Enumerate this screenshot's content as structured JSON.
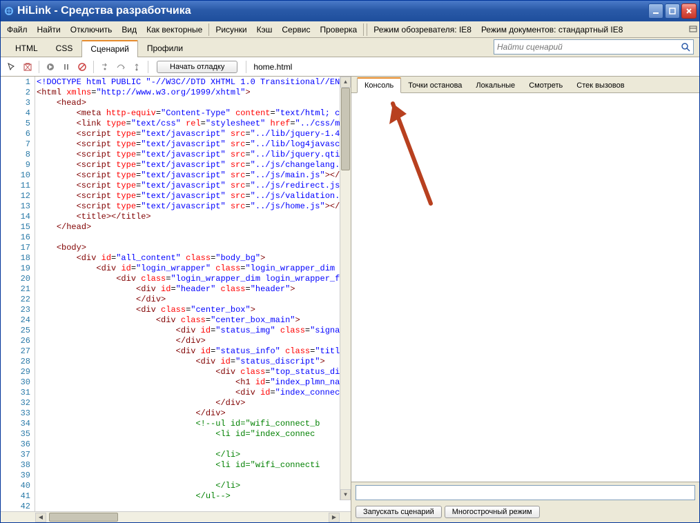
{
  "window": {
    "title": "HiLink - Средства разработчика"
  },
  "menu": {
    "items": [
      "Файл",
      "Найти",
      "Отключить",
      "Вид",
      "Как векторные",
      "Рисунки",
      "Кэш",
      "Сервис",
      "Проверка"
    ],
    "browser_mode_label": "Режим обозревателя: IE8",
    "doc_mode_label": "Режим документов: стандартный IE8"
  },
  "tabs": {
    "items": [
      "HTML",
      "CSS",
      "Сценарий",
      "Профили"
    ],
    "active": "Сценарий"
  },
  "search": {
    "placeholder": "Найти сценарий"
  },
  "toolbar": {
    "debug_label": "Начать отладку",
    "filename": "home.html"
  },
  "right_tabs": {
    "items": [
      "Консоль",
      "Точки останова",
      "Локальные",
      "Смотреть",
      "Стек вызовов"
    ],
    "active": "Консоль"
  },
  "console_buttons": {
    "run": "Запускать сценарий",
    "multiline": "Многострочный режим"
  },
  "code": {
    "start_line": 1,
    "lines": [
      [
        [
          "decl",
          "<!DOCTYPE html PUBLIC \"-//W3C//DTD XHTML 1.0 Transitional//EN"
        ]
      ],
      [
        [
          "tag",
          "<html "
        ],
        [
          "attr",
          "xmlns"
        ],
        [
          "txt",
          "="
        ],
        [
          "val",
          "\"http://www.w3.org/1999/xhtml\""
        ],
        [
          "tag",
          ">"
        ]
      ],
      [
        [
          "txt",
          "    "
        ],
        [
          "tag",
          "<head>"
        ]
      ],
      [
        [
          "txt",
          "        "
        ],
        [
          "tag",
          "<meta "
        ],
        [
          "attr",
          "http-equiv"
        ],
        [
          "txt",
          "="
        ],
        [
          "val",
          "\"Content-Type\""
        ],
        [
          "txt",
          " "
        ],
        [
          "attr",
          "content"
        ],
        [
          "txt",
          "="
        ],
        [
          "val",
          "\"text/html; c"
        ]
      ],
      [
        [
          "txt",
          "        "
        ],
        [
          "tag",
          "<link "
        ],
        [
          "attr",
          "type"
        ],
        [
          "txt",
          "="
        ],
        [
          "val",
          "\"text/css\""
        ],
        [
          "txt",
          " "
        ],
        [
          "attr",
          "rel"
        ],
        [
          "txt",
          "="
        ],
        [
          "val",
          "\"stylesheet\""
        ],
        [
          "txt",
          " "
        ],
        [
          "attr",
          "href"
        ],
        [
          "txt",
          "="
        ],
        [
          "val",
          "\"../css/m"
        ]
      ],
      [
        [
          "txt",
          "        "
        ],
        [
          "tag",
          "<script "
        ],
        [
          "attr",
          "type"
        ],
        [
          "txt",
          "="
        ],
        [
          "val",
          "\"text/javascript\""
        ],
        [
          "txt",
          " "
        ],
        [
          "attr",
          "src"
        ],
        [
          "txt",
          "="
        ],
        [
          "val",
          "\"../lib/jquery-1.4"
        ]
      ],
      [
        [
          "txt",
          "        "
        ],
        [
          "tag",
          "<script "
        ],
        [
          "attr",
          "type"
        ],
        [
          "txt",
          "="
        ],
        [
          "val",
          "\"text/javascript\""
        ],
        [
          "txt",
          " "
        ],
        [
          "attr",
          "src"
        ],
        [
          "txt",
          "="
        ],
        [
          "val",
          "\"../lib/log4javasc"
        ]
      ],
      [
        [
          "txt",
          "        "
        ],
        [
          "tag",
          "<script "
        ],
        [
          "attr",
          "type"
        ],
        [
          "txt",
          "="
        ],
        [
          "val",
          "\"text/javascript\""
        ],
        [
          "txt",
          " "
        ],
        [
          "attr",
          "src"
        ],
        [
          "txt",
          "="
        ],
        [
          "val",
          "\"../lib/jquery.qti"
        ]
      ],
      [
        [
          "txt",
          "        "
        ],
        [
          "tag",
          "<script "
        ],
        [
          "attr",
          "type"
        ],
        [
          "txt",
          "="
        ],
        [
          "val",
          "\"text/javascript\""
        ],
        [
          "txt",
          " "
        ],
        [
          "attr",
          "src"
        ],
        [
          "txt",
          "="
        ],
        [
          "val",
          "\"../js/changelang."
        ]
      ],
      [
        [
          "txt",
          "        "
        ],
        [
          "tag",
          "<script "
        ],
        [
          "attr",
          "type"
        ],
        [
          "txt",
          "="
        ],
        [
          "val",
          "\"text/javascript\""
        ],
        [
          "txt",
          " "
        ],
        [
          "attr",
          "src"
        ],
        [
          "txt",
          "="
        ],
        [
          "val",
          "\"../js/main.js\""
        ],
        [
          "tag",
          ">"
        ],
        [
          "tag",
          "</"
        ]
      ],
      [
        [
          "txt",
          "        "
        ],
        [
          "tag",
          "<script "
        ],
        [
          "attr",
          "type"
        ],
        [
          "txt",
          "="
        ],
        [
          "val",
          "\"text/javascript\""
        ],
        [
          "txt",
          " "
        ],
        [
          "attr",
          "src"
        ],
        [
          "txt",
          "="
        ],
        [
          "val",
          "\"../js/redirect.js"
        ]
      ],
      [
        [
          "txt",
          "        "
        ],
        [
          "tag",
          "<script "
        ],
        [
          "attr",
          "type"
        ],
        [
          "txt",
          "="
        ],
        [
          "val",
          "\"text/javascript\""
        ],
        [
          "txt",
          " "
        ],
        [
          "attr",
          "src"
        ],
        [
          "txt",
          "="
        ],
        [
          "val",
          "\"../js/validation."
        ]
      ],
      [
        [
          "txt",
          "        "
        ],
        [
          "tag",
          "<script "
        ],
        [
          "attr",
          "type"
        ],
        [
          "txt",
          "="
        ],
        [
          "val",
          "\"text/javascript\""
        ],
        [
          "txt",
          " "
        ],
        [
          "attr",
          "src"
        ],
        [
          "txt",
          "="
        ],
        [
          "val",
          "\"../js/home.js\""
        ],
        [
          "tag",
          ">"
        ],
        [
          "tag",
          "</"
        ]
      ],
      [
        [
          "txt",
          "        "
        ],
        [
          "tag",
          "<title></title>"
        ]
      ],
      [
        [
          "txt",
          "    "
        ],
        [
          "tag",
          "</head>"
        ]
      ],
      [
        [
          "txt",
          ""
        ]
      ],
      [
        [
          "txt",
          "    "
        ],
        [
          "tag",
          "<body>"
        ]
      ],
      [
        [
          "txt",
          "        "
        ],
        [
          "tag",
          "<div "
        ],
        [
          "attr",
          "id"
        ],
        [
          "txt",
          "="
        ],
        [
          "val",
          "\"all_content\""
        ],
        [
          "txt",
          " "
        ],
        [
          "attr",
          "class"
        ],
        [
          "txt",
          "="
        ],
        [
          "val",
          "\"body_bg\""
        ],
        [
          "tag",
          ">"
        ]
      ],
      [
        [
          "txt",
          "            "
        ],
        [
          "tag",
          "<div "
        ],
        [
          "attr",
          "id"
        ],
        [
          "txt",
          "="
        ],
        [
          "val",
          "\"login_wrapper\""
        ],
        [
          "txt",
          " "
        ],
        [
          "attr",
          "class"
        ],
        [
          "txt",
          "="
        ],
        [
          "val",
          "\"login_wrapper_dim"
        ]
      ],
      [
        [
          "txt",
          "                "
        ],
        [
          "tag",
          "<div "
        ],
        [
          "attr",
          "class"
        ],
        [
          "txt",
          "="
        ],
        [
          "val",
          "\"login_wrapper_dim login_wrapper_f"
        ]
      ],
      [
        [
          "txt",
          "                    "
        ],
        [
          "tag",
          "<div "
        ],
        [
          "attr",
          "id"
        ],
        [
          "txt",
          "="
        ],
        [
          "val",
          "\"header\""
        ],
        [
          "txt",
          " "
        ],
        [
          "attr",
          "class"
        ],
        [
          "txt",
          "="
        ],
        [
          "val",
          "\"header\""
        ],
        [
          "tag",
          ">"
        ]
      ],
      [
        [
          "txt",
          "                    "
        ],
        [
          "tag",
          "</div>"
        ]
      ],
      [
        [
          "txt",
          "                    "
        ],
        [
          "tag",
          "<div "
        ],
        [
          "attr",
          "class"
        ],
        [
          "txt",
          "="
        ],
        [
          "val",
          "\"center_box\""
        ],
        [
          "tag",
          ">"
        ]
      ],
      [
        [
          "txt",
          "                        "
        ],
        [
          "tag",
          "<div "
        ],
        [
          "attr",
          "class"
        ],
        [
          "txt",
          "="
        ],
        [
          "val",
          "\"center_box_main\""
        ],
        [
          "tag",
          ">"
        ]
      ],
      [
        [
          "txt",
          "                            "
        ],
        [
          "tag",
          "<div "
        ],
        [
          "attr",
          "id"
        ],
        [
          "txt",
          "="
        ],
        [
          "val",
          "\"status_img\""
        ],
        [
          "txt",
          " "
        ],
        [
          "attr",
          "class"
        ],
        [
          "txt",
          "="
        ],
        [
          "val",
          "\"signa"
        ]
      ],
      [
        [
          "txt",
          "                            "
        ],
        [
          "tag",
          "</div>"
        ]
      ],
      [
        [
          "txt",
          "                            "
        ],
        [
          "tag",
          "<div "
        ],
        [
          "attr",
          "id"
        ],
        [
          "txt",
          "="
        ],
        [
          "val",
          "\"status_info\""
        ],
        [
          "txt",
          " "
        ],
        [
          "attr",
          "class"
        ],
        [
          "txt",
          "="
        ],
        [
          "val",
          "\"titl"
        ]
      ],
      [
        [
          "txt",
          "                                "
        ],
        [
          "tag",
          "<div "
        ],
        [
          "attr",
          "id"
        ],
        [
          "txt",
          "="
        ],
        [
          "val",
          "\"status_discript\""
        ],
        [
          "tag",
          ">"
        ]
      ],
      [
        [
          "txt",
          "                                    "
        ],
        [
          "tag",
          "<div "
        ],
        [
          "attr",
          "class"
        ],
        [
          "txt",
          "="
        ],
        [
          "val",
          "\"top_status_di"
        ]
      ],
      [
        [
          "txt",
          "                                        "
        ],
        [
          "tag",
          "<h1 "
        ],
        [
          "attr",
          "id"
        ],
        [
          "txt",
          "="
        ],
        [
          "val",
          "\"index_plmn_na"
        ]
      ],
      [
        [
          "txt",
          "                                        "
        ],
        [
          "tag",
          "<div "
        ],
        [
          "attr",
          "id"
        ],
        [
          "txt",
          "="
        ],
        [
          "val",
          "\"index_connec"
        ]
      ],
      [
        [
          "txt",
          "                                    "
        ],
        [
          "tag",
          "</div>"
        ]
      ],
      [
        [
          "txt",
          "                                "
        ],
        [
          "tag",
          "</div>"
        ]
      ],
      [
        [
          "txt",
          "                                "
        ],
        [
          "cmt",
          "<!--ul id=\"wifi_connect_b"
        ]
      ],
      [
        [
          "txt",
          "                                    "
        ],
        [
          "cmt",
          "<li id=\"index_connec"
        ]
      ],
      [
        [
          "txt",
          ""
        ]
      ],
      [
        [
          "txt",
          "                                    "
        ],
        [
          "cmt",
          "</li>"
        ]
      ],
      [
        [
          "txt",
          "                                    "
        ],
        [
          "cmt",
          "<li id=\"wifi_connecti"
        ]
      ],
      [
        [
          "txt",
          ""
        ]
      ],
      [
        [
          "txt",
          "                                    "
        ],
        [
          "cmt",
          "</li>"
        ]
      ],
      [
        [
          "txt",
          "                                "
        ],
        [
          "cmt",
          "</ul-->"
        ]
      ],
      [
        [
          "txt",
          ""
        ]
      ]
    ]
  }
}
